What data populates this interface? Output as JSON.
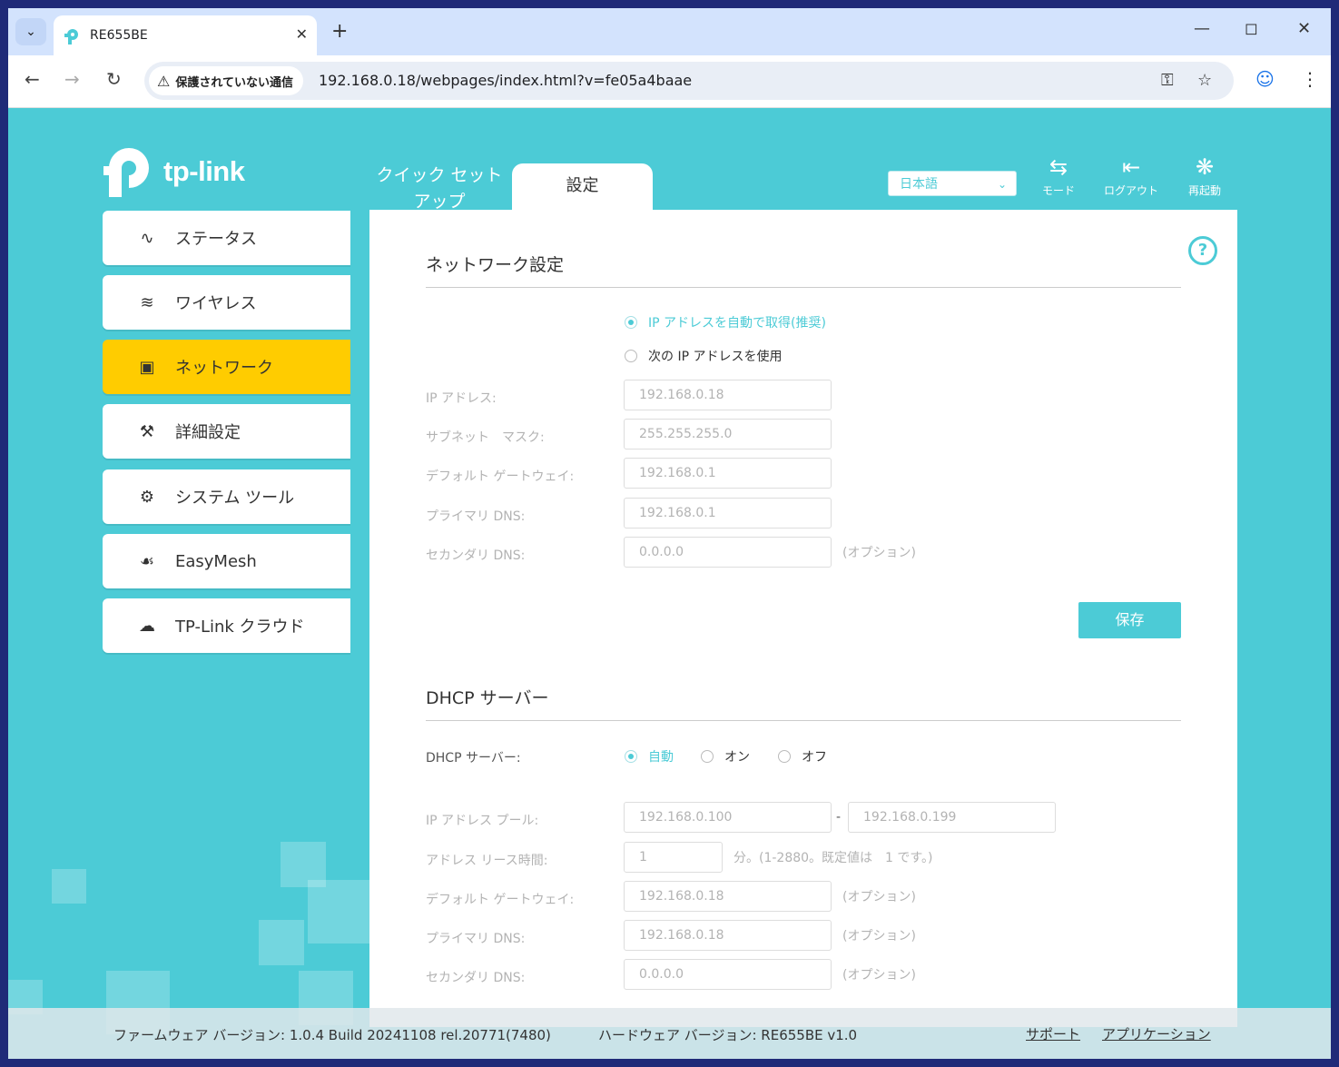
{
  "browser": {
    "tab_title": "RE655BE",
    "security_label": "保護されていない通信",
    "url": "192.168.0.18/webpages/index.html?v=fe05a4baae"
  },
  "header": {
    "logo_text": "tp-link",
    "quick_setup_line1": "クイック セット",
    "quick_setup_line2": "アップ",
    "settings_tab": "設定",
    "language": "日本語",
    "mode_label": "モード",
    "logout_label": "ログアウト",
    "reboot_label": "再起動"
  },
  "sidebar": {
    "items": [
      {
        "label": "ステータス",
        "icon": "status-pulse-icon"
      },
      {
        "label": "ワイヤレス",
        "icon": "wireless-icon"
      },
      {
        "label": "ネットワーク",
        "icon": "network-icon",
        "active": true
      },
      {
        "label": "詳細設定",
        "icon": "wrench-icon"
      },
      {
        "label": "システム ツール",
        "icon": "gear-icon"
      },
      {
        "label": "EasyMesh",
        "icon": "mesh-icon"
      },
      {
        "label": "TP-Link クラウド",
        "icon": "cloud-icon"
      }
    ]
  },
  "network": {
    "title": "ネットワーク設定",
    "option_auto": "IP アドレスを自動で取得(推奨)",
    "option_manual": "次の IP アドレスを使用",
    "ip_label": "IP アドレス:",
    "ip_value": "192.168.0.18",
    "subnet_label": "サブネット　マスク:",
    "subnet_value": "255.255.255.0",
    "gateway_label": "デフォルト ゲートウェイ:",
    "gateway_value": "192.168.0.1",
    "dns1_label": "プライマリ DNS:",
    "dns1_value": "192.168.0.1",
    "dns2_label": "セカンダリ DNS:",
    "dns2_value": "0.0.0.0",
    "optional": "(オプション)",
    "save_label": "保存"
  },
  "dhcp": {
    "title": "DHCP サーバー",
    "server_label": "DHCP サーバー:",
    "opt_auto": "自動",
    "opt_on": "オン",
    "opt_off": "オフ",
    "pool_label": "IP アドレス プール:",
    "pool_start": "192.168.0.100",
    "pool_sep": "-",
    "pool_end": "192.168.0.199",
    "lease_label": "アドレス リース時間:",
    "lease_value": "1",
    "lease_hint": "分。(1-2880。既定値は　1 です。)",
    "gateway_label": "デフォルト ゲートウェイ:",
    "gateway_value": "192.168.0.18",
    "dns1_label": "プライマリ DNS:",
    "dns1_value": "192.168.0.18",
    "dns2_label": "セカンダリ DNS:",
    "dns2_value": "0.0.0.0",
    "optional": "(オプション)"
  },
  "footer": {
    "firmware": "ファームウェア バージョン: 1.0.4 Build 20241108 rel.20771(7480)",
    "hardware": "ハードウェア バージョン: RE655BE v1.0",
    "support": "サポート",
    "app": "アプリケーション"
  }
}
